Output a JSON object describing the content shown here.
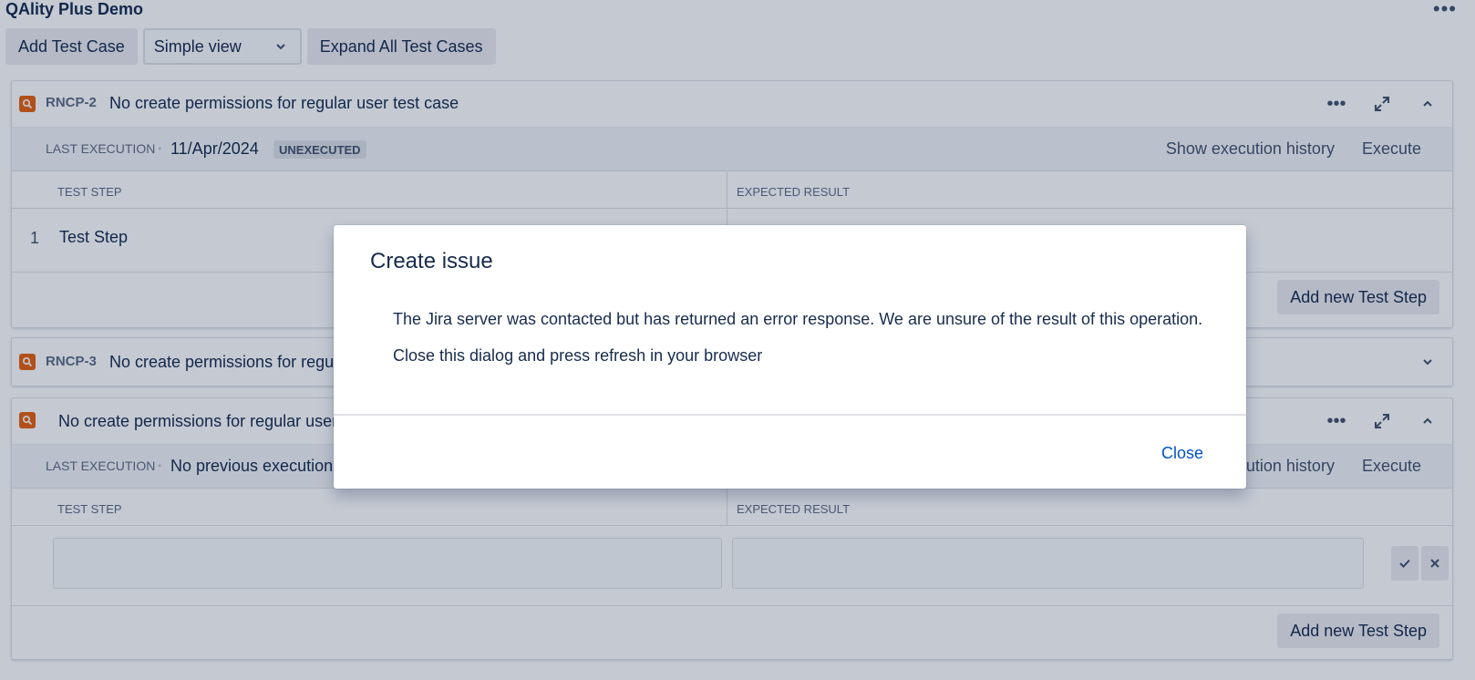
{
  "app": {
    "title": "QAlity Plus Demo",
    "more_icon": "more-horizontal-icon"
  },
  "toolbar": {
    "add_test_case": "Add Test Case",
    "view_select": {
      "value": "Simple view",
      "icon": "chevron-down-icon"
    },
    "expand_all": "Expand All Test Cases"
  },
  "cards": [
    {
      "key": "RNCP-2",
      "title": "No create permissions for regular user test case",
      "last_execution_label": "LAST EXECUTION",
      "last_execution_value": "11/Apr/2024",
      "status_badge": "UNEXECUTED",
      "show_history": "Show execution history",
      "execute": "Execute",
      "col_test_step": "TEST STEP",
      "col_expected": "EXPECTED RESULT",
      "steps": [
        {
          "num": "1",
          "text": "Test Step"
        }
      ],
      "add_step": "Add new Test Step"
    },
    {
      "key": "RNCP-3",
      "title": "No create permissions for regula"
    },
    {
      "key": "",
      "title": "No create permissions for regular user t",
      "last_execution_label": "LAST EXECUTION",
      "last_execution_value": "No previous executions",
      "show_history": "cution history",
      "execute": "Execute",
      "col_test_step": "TEST STEP",
      "col_expected": "EXPECTED RESULT",
      "add_step": "Add new Test Step"
    }
  ],
  "modal": {
    "title": "Create issue",
    "message_1": "The Jira server was contacted but has returned an error response. We are unsure of the result of this operation.",
    "message_2": "Close this dialog and press refresh in your browser",
    "close": "Close"
  },
  "colors": {
    "accent": "#0052cc",
    "issue_icon": "#e8610e",
    "overlay": "rgba(9,30,66,0.24)"
  }
}
